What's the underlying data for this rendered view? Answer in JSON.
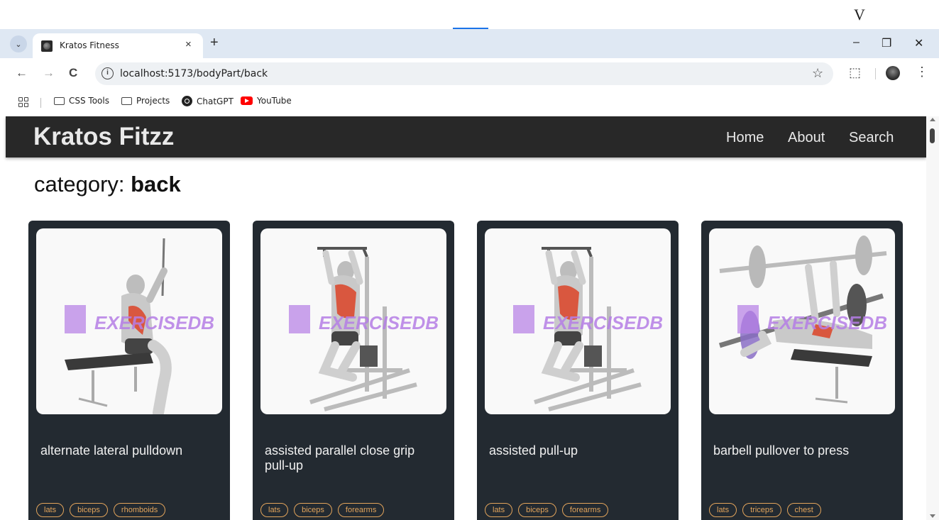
{
  "top_marker": "V",
  "browser": {
    "tab_title": "Kratos Fitness",
    "tab_close": "×",
    "new_tab": "+",
    "tab_menu": "⌄",
    "window_minimize": "–",
    "window_restore": "❐",
    "window_close": "✕",
    "url": "localhost:5173/bodyPart/back",
    "nav_back": "←",
    "nav_forward": "→",
    "nav_reload": "C",
    "bookmark_star": "☆",
    "extensions_icon": "⬚",
    "menu_icon": "⋮",
    "bookmarks": [
      {
        "label": "CSS Tools",
        "icon": "folder-icon"
      },
      {
        "label": "Projects",
        "icon": "folder-icon"
      },
      {
        "label": "ChatGPT",
        "icon": "chatgpt-icon"
      },
      {
        "label": "YouTube",
        "icon": "youtube-icon"
      }
    ]
  },
  "site": {
    "logo": "Kratos Fitzz",
    "nav": [
      "Home",
      "About",
      "Search"
    ],
    "category_prefix": "category: ",
    "category": "back"
  },
  "exercises": [
    {
      "name": "alternate lateral pulldown",
      "tags": [
        "lats",
        "biceps",
        "rhomboids"
      ]
    },
    {
      "name": "assisted parallel close grip pull-up",
      "tags": [
        "lats",
        "biceps",
        "forearms"
      ]
    },
    {
      "name": "assisted pull-up",
      "tags": [
        "lats",
        "biceps",
        "forearms"
      ]
    },
    {
      "name": "barbell pullover to press",
      "tags": [
        "lats",
        "triceps",
        "chest"
      ]
    }
  ],
  "watermark": "EXERCISEDB",
  "colors": {
    "nav_bg": "#282828",
    "card_bg": "#232a31",
    "tag_accent": "#e2a45b",
    "watermark": "#b57ee6",
    "muscle_highlight": "#d9573f"
  }
}
